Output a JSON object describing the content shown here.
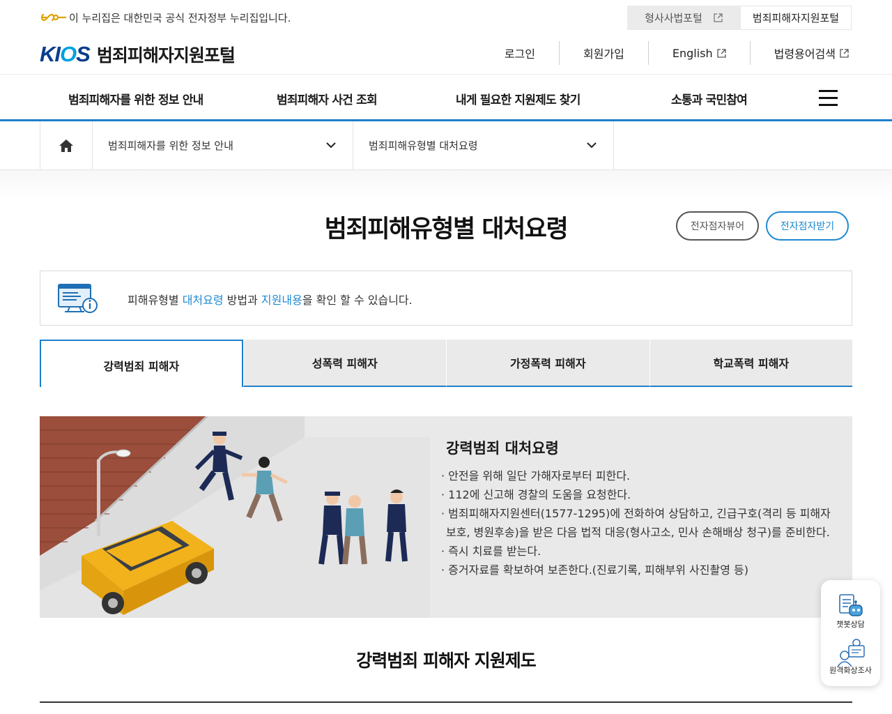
{
  "gov_banner": {
    "text": "이 누리집은 대한민국 공식 전자정부 누리집입니다."
  },
  "external_links": [
    {
      "label": "형사사법포털"
    },
    {
      "label": "범죄피해자지원포털"
    }
  ],
  "logo": {
    "brand_k": "KI",
    "brand_o": "O",
    "brand_s": "S",
    "site_name": "범죄피해자지원포털"
  },
  "utility_nav": {
    "login": "로그인",
    "signup": "회원가입",
    "english": "English",
    "legal_terms": "법령용어검색"
  },
  "gnb": {
    "items": [
      "범죄피해자를 위한 정보 안내",
      "범죄피해자 사건 조회",
      "내게 필요한 지원제도 찾기",
      "소통과 국민참여"
    ]
  },
  "breadcrumb": {
    "level1": "범죄피해자를 위한 정보 안내",
    "level2": "범죄피해유형별 대처요령"
  },
  "page": {
    "title": "범죄피해유형별 대처요령",
    "braille_viewer": "전자점자뷰어",
    "braille_download": "전자점자받기"
  },
  "info": {
    "prefix": "피해유형별 ",
    "highlight1": "대처요령",
    "middle": " 방법과 ",
    "highlight2": "지원내용",
    "suffix": "을 확인 할 수 있습니다."
  },
  "tabs": [
    "강력범죄 피해자",
    "성폭력 피해자",
    "가정폭력 피해자",
    "학교폭력 피해자"
  ],
  "active_tab": 0,
  "panel": {
    "title": "강력범죄 대처요령",
    "items": [
      "· 안전을 위해 일단 가해자로부터 피한다.",
      "· 112에 신고해 경찰의 도움을 요청한다.",
      "· 범죄피해자지원센터(1577-1295)에 전화하여 상담하고, 긴급구호(격리 등 피해자보호, 병원후송)을 받은 다음 법적 대응(형사고소, 민사 손해배상 청구)를 준비한다.",
      "· 즉시 치료를 받는다.",
      "· 증거자료를 확보하여 보존한다.(진료기록, 피해부위 사진촬영 등)"
    ]
  },
  "section": {
    "title": "강력범죄 피해자 지원제도"
  },
  "quick_menu": {
    "chatbot": "챗봇상담",
    "video": "원격화상조사"
  },
  "colors": {
    "accent": "#1e7fc9",
    "highlight": "#1e8ad1",
    "brand": "#0a3d8c"
  }
}
